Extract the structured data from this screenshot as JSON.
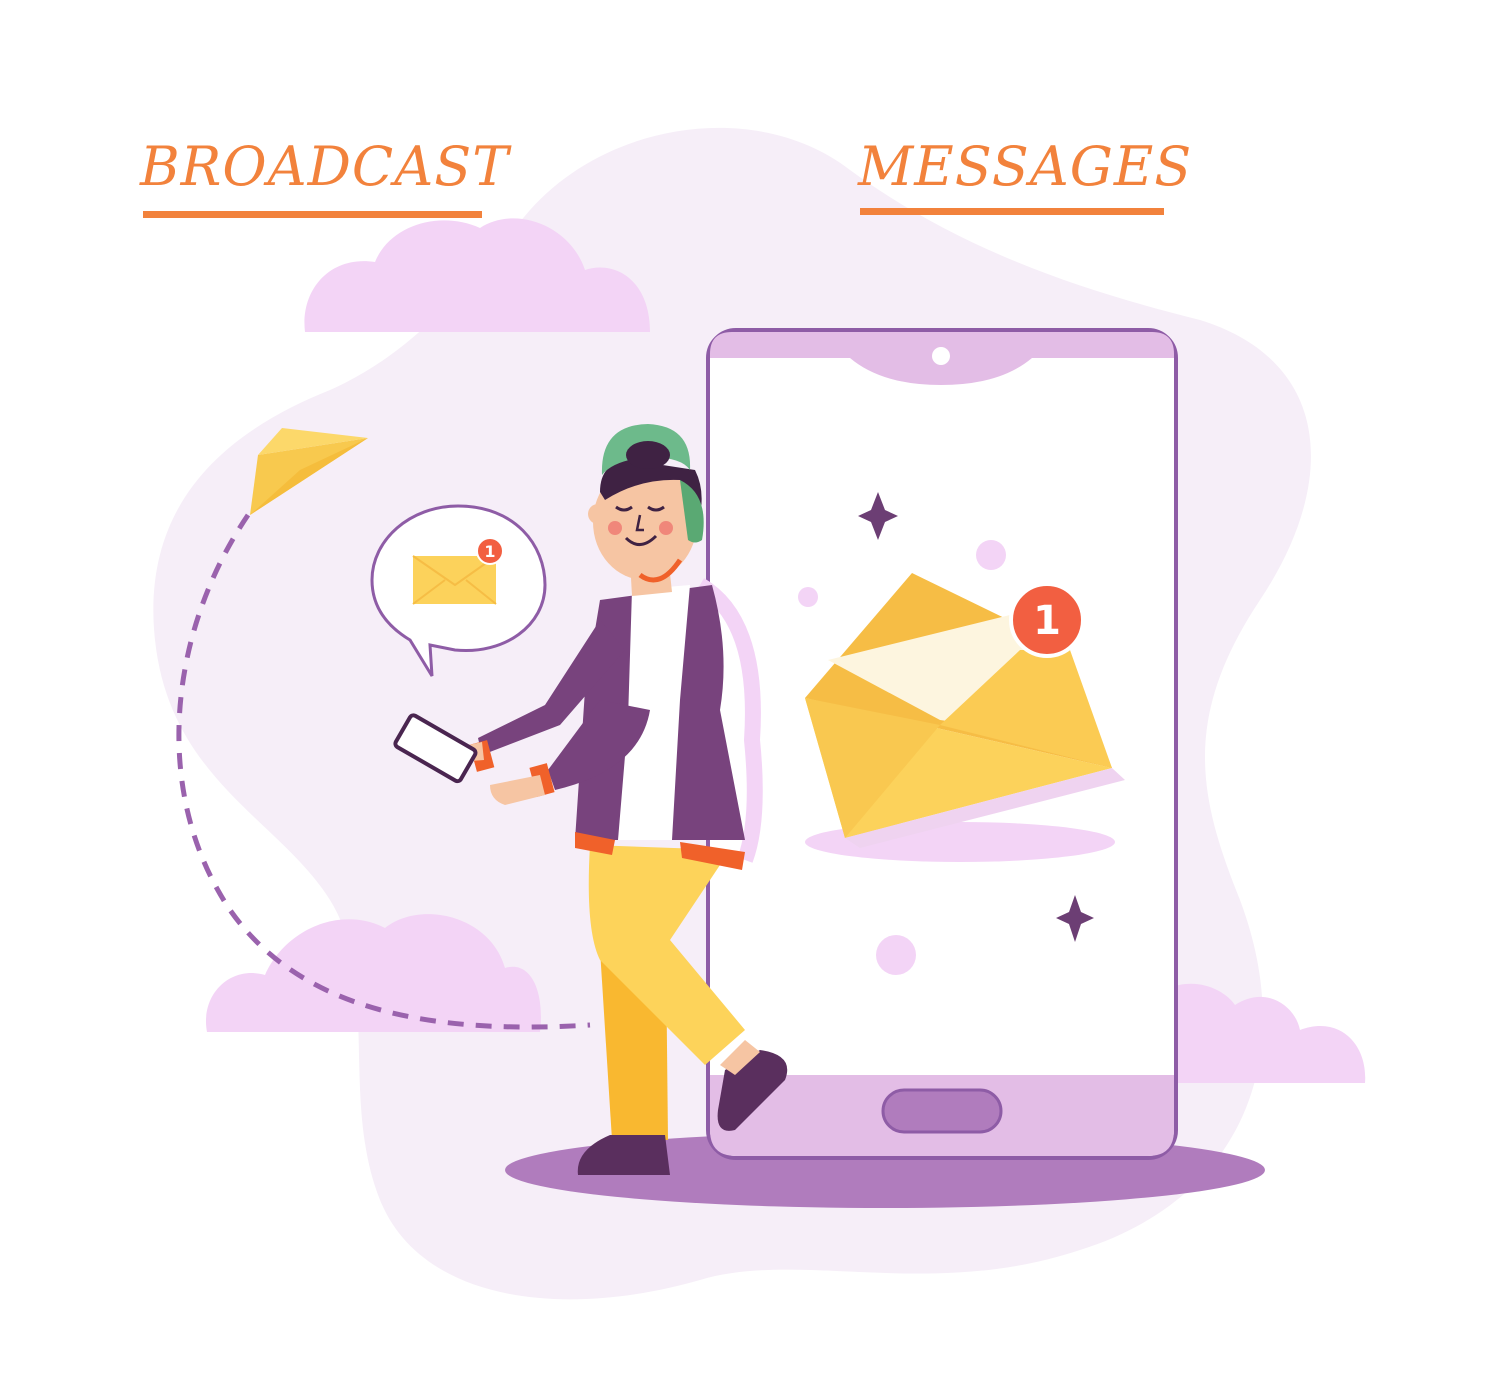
{
  "headings": {
    "left": "BROADCAST",
    "right": "MESSAGES"
  },
  "badges": {
    "bubble_count": "1",
    "envelope_count": "1"
  },
  "colors": {
    "heading": "#f2823c",
    "blob": "#f6eef8",
    "cloud": "#f3d4f6",
    "phone_frame": "#8e5ca6",
    "phone_bar": "#e3bde6",
    "envelope": "#fcd25b",
    "badge": "#f25f41",
    "jacket": "#78437d",
    "pants": "#fdd35a"
  },
  "icons": {
    "paper_plane": "paper-plane-icon",
    "envelope": "envelope-icon",
    "sparkle": "sparkle-icon"
  }
}
